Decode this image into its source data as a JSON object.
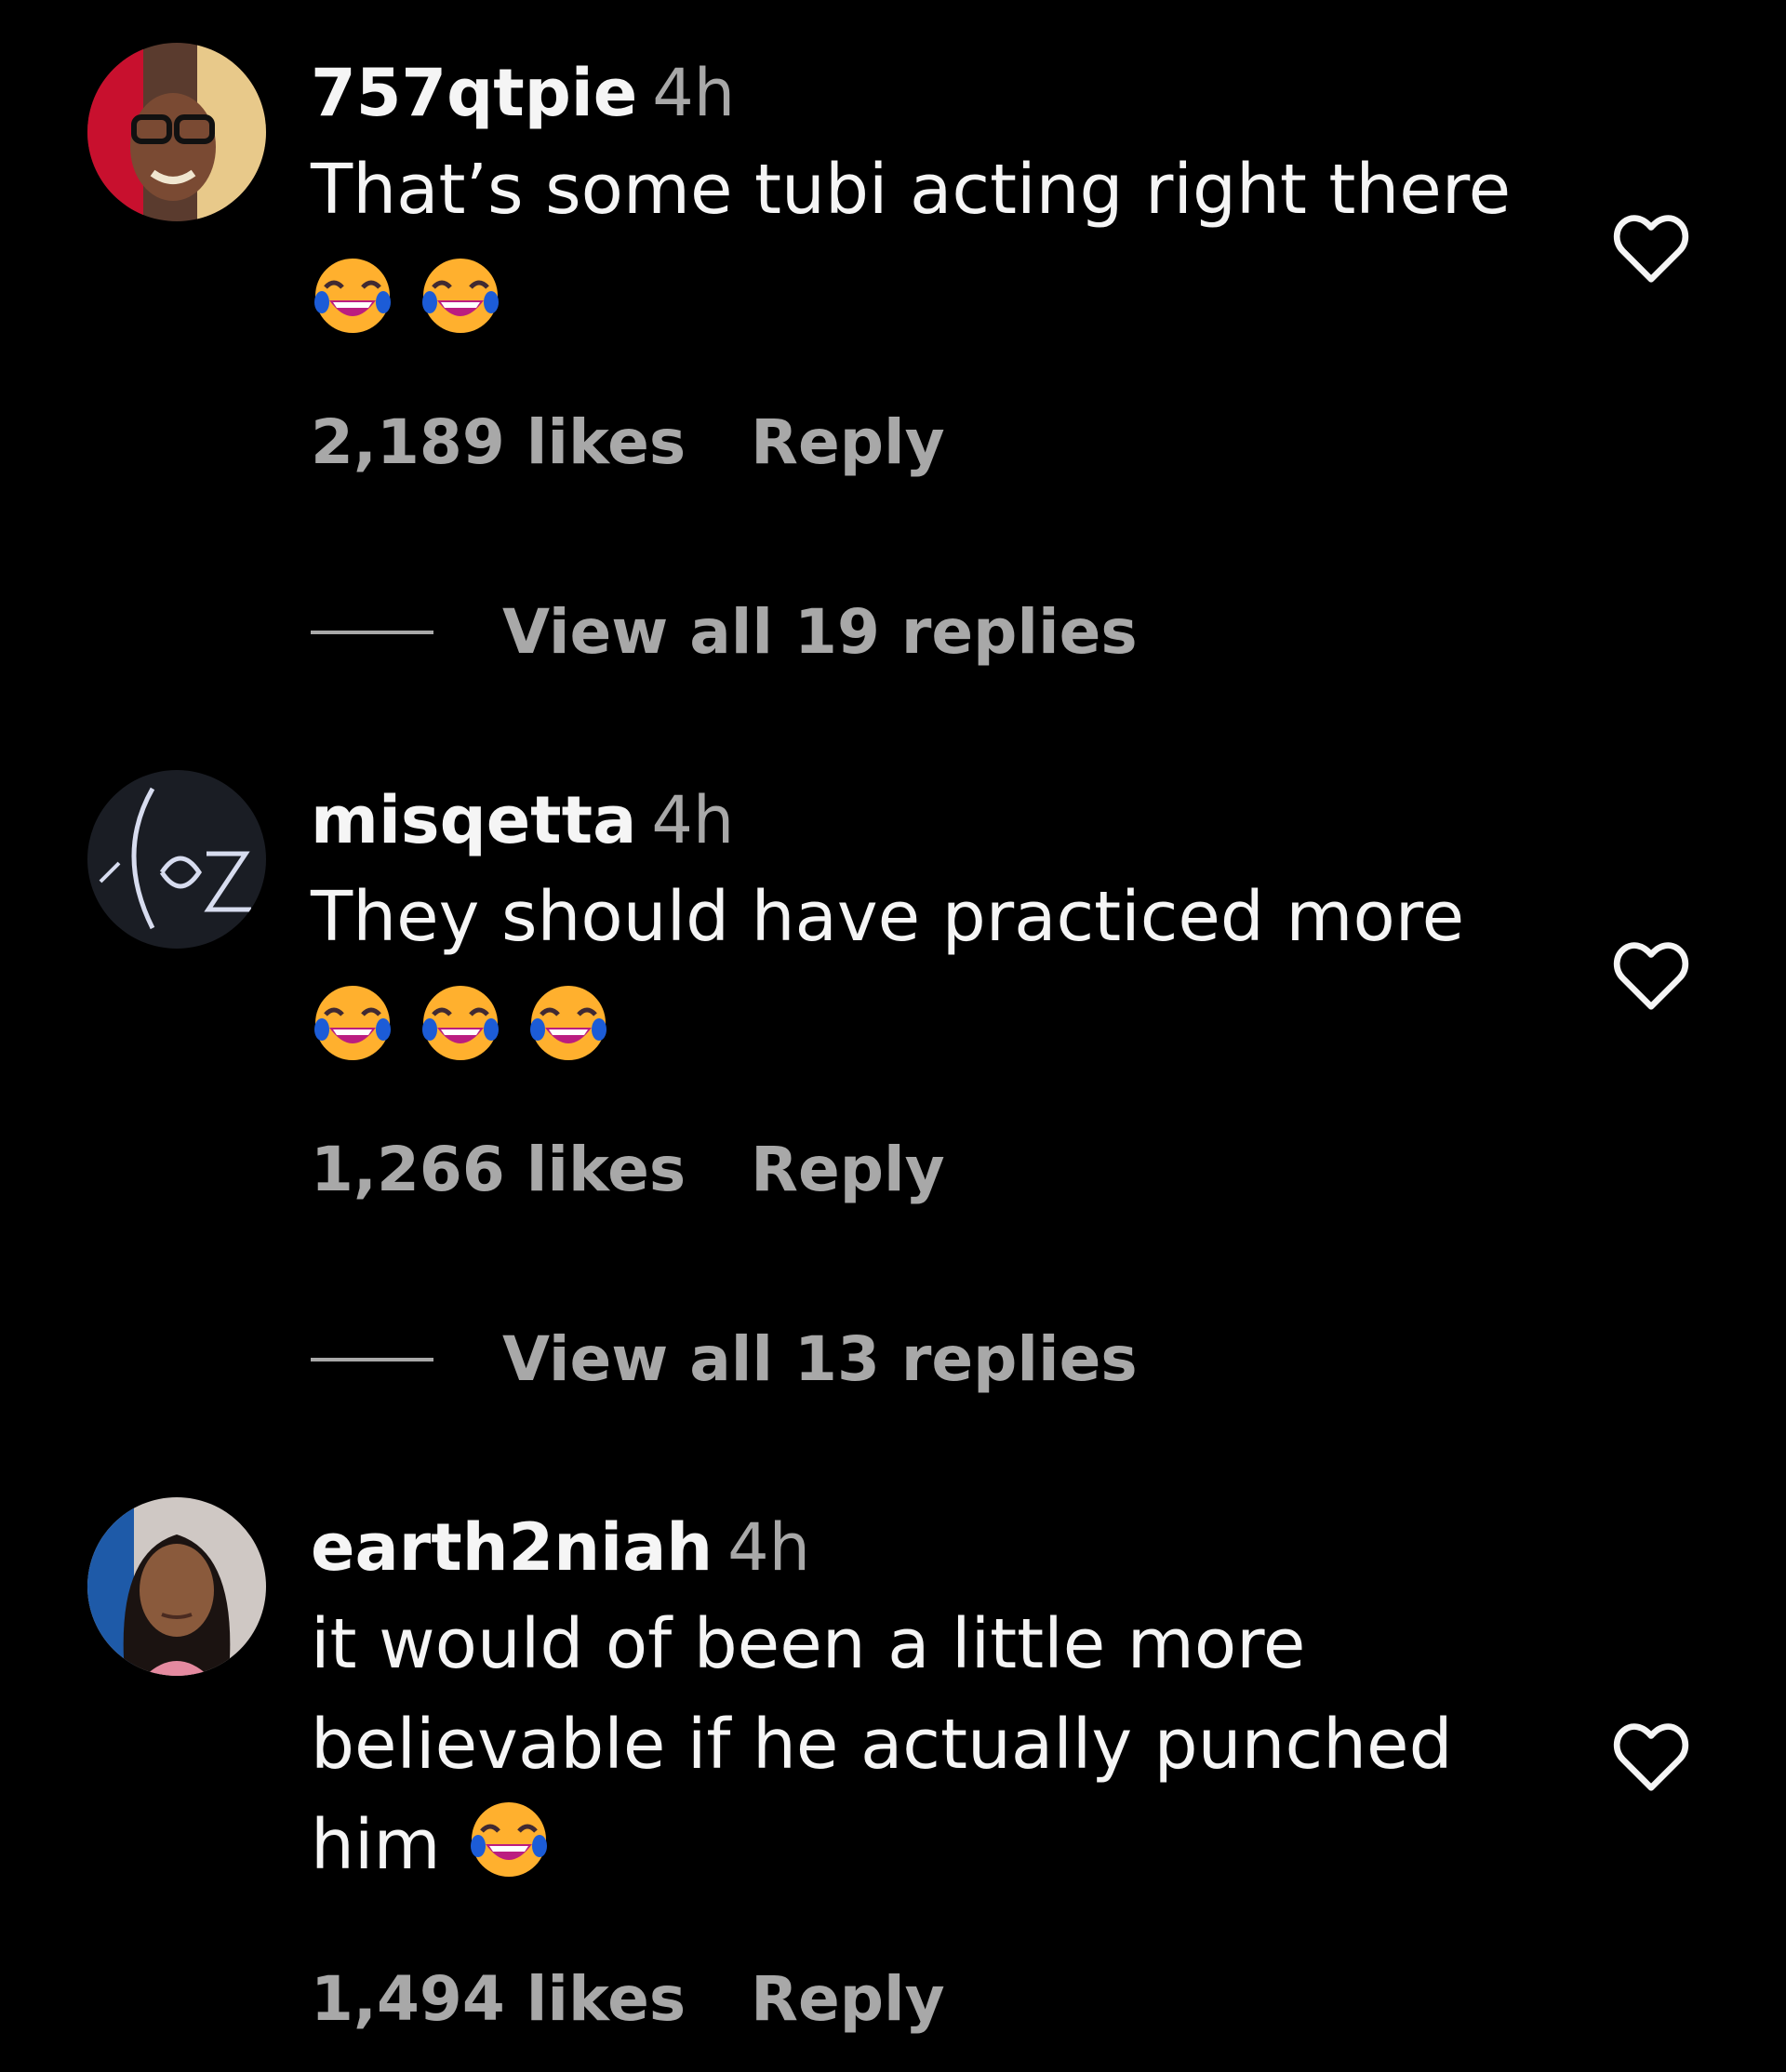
{
  "comments": [
    {
      "username": "757qtpie",
      "time": "4h",
      "text_lines": [
        "That’s some tubi acting right there"
      ],
      "emoji_count": 2,
      "likes": "2,189 likes",
      "reply_label": "Reply",
      "view_replies": "View all 19 replies"
    },
    {
      "username": "misqetta",
      "time": "4h",
      "text_lines": [
        "They should have practiced more"
      ],
      "emoji_count": 3,
      "likes": "1,266 likes",
      "reply_label": "Reply",
      "view_replies": "View all 13 replies"
    },
    {
      "username": "earth2niah",
      "time": "4h",
      "text_lines": [
        "it would of been a little more",
        "believable if he actually punched",
        "him"
      ],
      "emoji_count": 1,
      "likes": "1,494 likes",
      "reply_label": "Reply"
    }
  ],
  "icons": {
    "heart": "heart-outline-icon",
    "emoji": "face-with-tears-of-joy-emoji"
  },
  "colors": {
    "background": "#000000",
    "primary_text": "#f5f5f5",
    "secondary_text": "#a8a8a8"
  }
}
